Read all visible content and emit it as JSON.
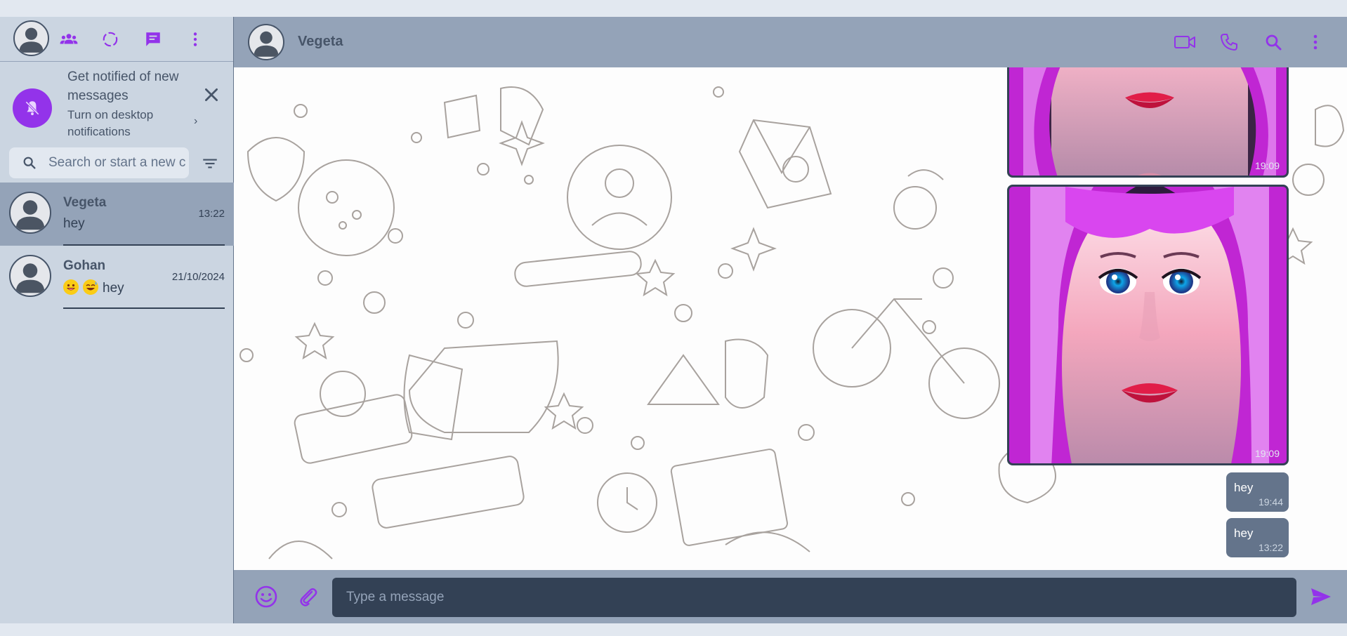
{
  "sidebar": {
    "notification": {
      "title": "Get notified of new messages",
      "subtitle": "Turn on desktop notifications"
    },
    "search": {
      "placeholder": "Search or start a new chat"
    },
    "chats": [
      {
        "name": "Vegeta",
        "last_message": "hey",
        "time": "13:22",
        "active": true
      },
      {
        "name": "Gohan",
        "last_message": "hey",
        "emojis": [
          "grinning-face",
          "sweat-smile-face"
        ],
        "time": "21/10/2024",
        "active": false
      }
    ]
  },
  "conversation": {
    "contact_name": "Vegeta",
    "messages": [
      {
        "type": "image",
        "time": "19:09"
      },
      {
        "type": "image",
        "time": "19:09"
      },
      {
        "type": "text",
        "text": "hey",
        "time": "19:44"
      },
      {
        "type": "text",
        "text": "hey",
        "time": "13:22"
      }
    ],
    "composer": {
      "placeholder": "Type a message"
    }
  },
  "icons": {
    "header_left": [
      "profile-avatar",
      "communities-icon",
      "status-icon",
      "new-chat-icon",
      "menu-icon"
    ],
    "header_right": [
      "video-call-icon",
      "voice-call-icon",
      "search-icon",
      "menu-icon"
    ],
    "composer": [
      "emoji-icon",
      "attach-icon",
      "send-icon"
    ]
  },
  "colors": {
    "accent": "#9333ea",
    "sidebar_bg": "#cbd5e1",
    "header_bg": "#94a3b8",
    "active_chat_bg": "#94a3b8",
    "outgoing_bubble": "#64748b",
    "input_bg": "#334155"
  }
}
